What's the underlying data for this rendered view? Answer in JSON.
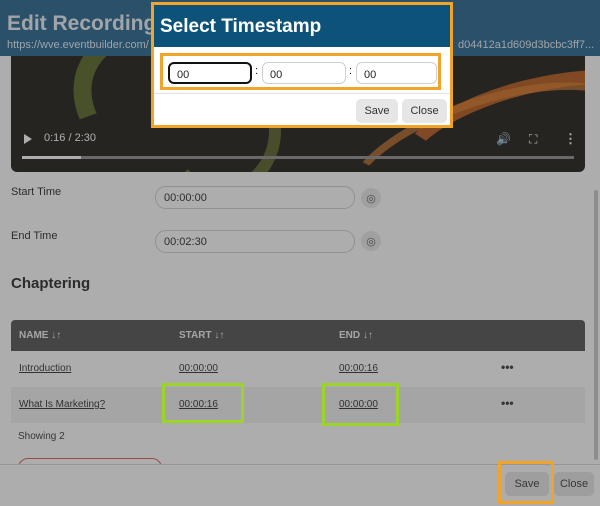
{
  "dialog": {
    "title": "Edit Recording",
    "url": "https://wve.eventbuilder.com/",
    "url_tail": "d04412a1d609d3bcbc3ff7..."
  },
  "video": {
    "time": "0:16 / 2:30",
    "progress": 0.107,
    "icons": [
      "play-icon",
      "volume-icon",
      "fullscreen-icon",
      "more-icon"
    ]
  },
  "form": {
    "start_label": "Start Time",
    "start_value": "00:00:00",
    "end_label": "End Time",
    "end_value": "00:02:30"
  },
  "chaptering": {
    "title": "Chaptering",
    "headers": [
      "NAME",
      "START",
      "END"
    ],
    "sort_glyph": "↓↑",
    "rows": [
      {
        "name": "Introduction",
        "start": "00:00:00",
        "end": "00:00:16",
        "menu": "•••"
      },
      {
        "name": "What Is Marketing?",
        "start": "00:00:16",
        "end": "00:00:00",
        "menu": "•••"
      }
    ],
    "showing": "Showing 2"
  },
  "footer": {
    "save": "Save",
    "close": "Close"
  },
  "popup": {
    "title": "Select Timestamp",
    "hours": "00",
    "minutes": "00",
    "seconds": "00",
    "separator": ":",
    "save": "Save",
    "close": "Close"
  },
  "colors": {
    "header": "#1f5f8b",
    "popup_header": "#0d5379",
    "highlight_orange": "#f0a52a",
    "highlight_green": "#9bd52a"
  }
}
